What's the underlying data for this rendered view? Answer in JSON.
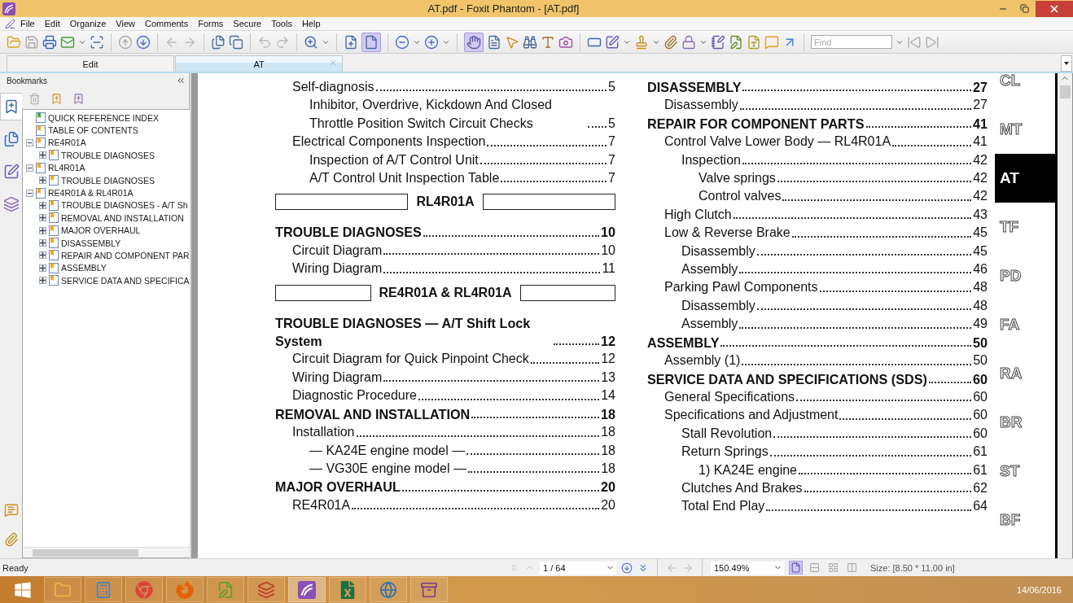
{
  "window": {
    "title": "AT.pdf - Foxit Phantom - [AT.pdf]"
  },
  "menu": [
    "File",
    "Edit",
    "Organize",
    "View",
    "Comments",
    "Forms",
    "Secure",
    "Tools",
    "Help"
  ],
  "toolbar": {
    "fit_page": {
      "selected": true
    },
    "hand_tool": {
      "selected": true
    },
    "find": {
      "placeholder": "Find"
    }
  },
  "tabs": [
    {
      "label": "Edit",
      "selected": false,
      "closable": false
    },
    {
      "label": "AT",
      "selected": true,
      "closable": true
    }
  ],
  "sidebar": {
    "title": "Bookmarks",
    "panel_tabs": [
      {
        "selected": true
      },
      {
        "selected": false
      },
      {
        "selected": false
      },
      {
        "selected": false
      }
    ],
    "tree": [
      {
        "label": "QUICK REFERENCE INDEX",
        "color": "#3aa83a"
      },
      {
        "label": "TABLE OF CONTENTS",
        "color": "#f0a820"
      },
      {
        "label": "RE4R01A",
        "color": "#f0a820",
        "expanded": true,
        "children": [
          {
            "label": "TROUBLE DIAGNOSES",
            "color": "#f0a820",
            "expanded": false
          }
        ]
      },
      {
        "label": "RL4R01A",
        "color": "#f0a820",
        "expanded": true,
        "children": [
          {
            "label": "TROUBLE DIAGNOSES",
            "color": "#f0a820",
            "expanded": false
          }
        ]
      },
      {
        "label": "RE4R01A & RL4R01A",
        "color": "#f0a820",
        "expanded": true,
        "children": [
          {
            "label": "TROUBLE DIAGNOSES - A/T Sh",
            "color": "#f0a820",
            "expanded": false
          },
          {
            "label": "REMOVAL AND INSTALLATION",
            "color": "#f0a820",
            "expanded": false
          },
          {
            "label": "MAJOR OVERHAUL",
            "color": "#f0a820",
            "expanded": false
          },
          {
            "label": "DISASSEMBLY",
            "color": "#f0a820",
            "expanded": false
          },
          {
            "label": "REPAIR AND COMPONENT PAR",
            "color": "#f0a820",
            "expanded": false
          },
          {
            "label": "ASSEMBLY",
            "color": "#f0a820",
            "expanded": false
          },
          {
            "label": "SERVICE DATA AND SPECIFICA",
            "color": "#f0a820",
            "expanded": false
          }
        ]
      }
    ]
  },
  "document": {
    "left_column": [
      {
        "kind": "entry",
        "title": "Self-diagnosis",
        "page": "5",
        "children": [
          {
            "title": "Inhibitor, Overdrive, Kickdown And Closed Throttle Position Switch Circuit Checks",
            "page": "5"
          }
        ]
      },
      {
        "kind": "entry",
        "title": "Electrical Components Inspection",
        "page": "7",
        "children": [
          {
            "title": "Inspection of A/T Control Unit",
            "page": "7"
          },
          {
            "title": "A/T Control Unit Inspection Table",
            "page": "7"
          }
        ]
      },
      {
        "kind": "banner",
        "title": "RL4R01A"
      },
      {
        "kind": "heading",
        "title": "TROUBLE DIAGNOSES",
        "page": "10",
        "children": [
          {
            "title": "Circuit Diagram",
            "page": "10"
          },
          {
            "title": "Wiring Diagram",
            "page": "11"
          }
        ]
      },
      {
        "kind": "banner",
        "title": "RE4R01A & RL4R01A"
      },
      {
        "kind": "heading",
        "title": "TROUBLE DIAGNOSES — A/T Shift Lock System",
        "page": "12",
        "children": [
          {
            "title": "Circuit Diagram for Quick Pinpoint Check",
            "page": "12"
          },
          {
            "title": "Wiring Diagram",
            "page": "13"
          },
          {
            "title": "Diagnostic Procedure",
            "page": "14"
          }
        ]
      },
      {
        "kind": "heading",
        "title": "REMOVAL AND INSTALLATION",
        "page": "18",
        "children": [
          {
            "title": "Installation",
            "page": "18",
            "children": [
              {
                "title": "— KA24E engine model —",
                "page": "18"
              },
              {
                "title": "— VG30E engine model —",
                "page": "18"
              }
            ]
          }
        ]
      },
      {
        "kind": "heading",
        "title": "MAJOR OVERHAUL",
        "page": "20",
        "children": [
          {
            "title": "RE4R01A",
            "page": "20"
          }
        ]
      }
    ],
    "right_column": [
      {
        "kind": "heading",
        "title": "DISASSEMBLY",
        "page": "27",
        "children": [
          {
            "title": "Disassembly",
            "page": "27"
          }
        ]
      },
      {
        "kind": "heading",
        "title": "REPAIR FOR COMPONENT PARTS",
        "page": "41",
        "children": [
          {
            "title": "Control Valve Lower Body — RL4R01A",
            "page": "41",
            "children": [
              {
                "title": "Inspection",
                "page": "42",
                "children": [
                  {
                    "title": "Valve springs",
                    "page": "42"
                  },
                  {
                    "title": "Control valves",
                    "page": "42"
                  }
                ]
              }
            ]
          },
          {
            "title": "High Clutch",
            "page": "43"
          },
          {
            "title": "Low & Reverse Brake",
            "page": "45",
            "children": [
              {
                "title": "Disassembly",
                "page": "45"
              },
              {
                "title": "Assembly",
                "page": "46"
              }
            ]
          },
          {
            "title": "Parking Pawl Components",
            "page": "48",
            "children": [
              {
                "title": "Disassembly",
                "page": "48"
              },
              {
                "title": "Assembly",
                "page": "49"
              }
            ]
          }
        ]
      },
      {
        "kind": "heading",
        "title": "ASSEMBLY",
        "page": "50",
        "children": [
          {
            "title": "Assembly (1)",
            "page": "50"
          }
        ]
      },
      {
        "kind": "heading",
        "title": "SERVICE DATA AND SPECIFICATIONS (SDS)",
        "page": "60",
        "children": [
          {
            "title": "General Specifications",
            "page": "60"
          },
          {
            "title": "Specifications and Adjustment",
            "page": "60",
            "children": [
              {
                "title": "Stall Revolution",
                "page": "60"
              },
              {
                "title": "Return Springs",
                "page": "61",
                "children": [
                  {
                    "title": "1)  KA24E engine",
                    "page": "61"
                  }
                ]
              },
              {
                "title": "Clutches And Brakes",
                "page": "62"
              },
              {
                "title": "Total End Play",
                "page": "64"
              }
            ]
          }
        ]
      }
    ],
    "section_tabs": [
      {
        "label": "CL",
        "selected": false
      },
      {
        "label": "MT",
        "selected": false
      },
      {
        "label": "AT",
        "selected": true
      },
      {
        "label": "TF",
        "selected": false
      },
      {
        "label": "PD",
        "selected": false
      },
      {
        "label": "FA",
        "selected": false
      },
      {
        "label": "RA",
        "selected": false
      },
      {
        "label": "BR",
        "selected": false
      },
      {
        "label": "ST",
        "selected": false
      },
      {
        "label": "BF",
        "selected": false
      }
    ]
  },
  "status_bar": {
    "status": "Ready",
    "page": "1 / 64",
    "zoom": "150.49%",
    "view_modes": [
      {
        "selected": true
      },
      {
        "selected": false
      },
      {
        "selected": false
      },
      {
        "selected": false
      }
    ],
    "size": "Size: [8.50 * 11.00 in]"
  },
  "taskbar": {
    "apps": [
      {
        "selected": false
      },
      {
        "selected": false
      },
      {
        "selected": false
      },
      {
        "selected": false
      },
      {
        "selected": false
      },
      {
        "selected": false
      },
      {
        "selected": true
      },
      {
        "selected": false
      },
      {
        "selected": false
      },
      {
        "selected": false
      }
    ],
    "date": "14/06/2016"
  }
}
